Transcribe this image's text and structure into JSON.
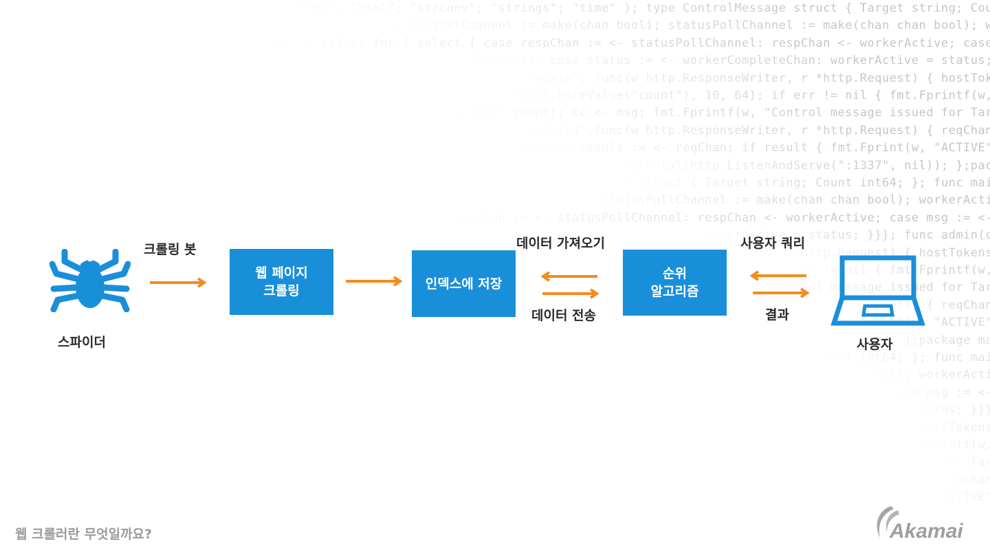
{
  "background_code": [
    "rt ( \"fmt\"; \"html\"; \"strconv\"; \"strings\"; \"time\" ); type ControlMessage struct { Target string; Cou",
    "n() { controlChannel := make(chan bool); statusPollChannel := make(chan chan bool); w",
    "tive := false; for { select { case respChan := <- statusPollChannel: respChan <- workerActive; case",
    "msg.Count); case status := <- workerCompleteChan: workerActive = status;",
    "e(\"/admin\", func(w http.ResponseWriter, r *http.Request) { hostTok",
    "rseInt(r.FormValue(\"count\"), 10, 64); if err != nil { fmt.Fprintf(w,",
    "ountErr: count}; cc <- msg; fmt.Fprintf(w, \"Control message issued for Tar",
    "c(\"/status\",func(w http.ResponseWriter, r *http.Request) { reqChan",
    "eqChan; result := <- reqChan; if result { fmt.Fprint(w, \"ACTIVE\"",
    "log.Fatal(http.ListenAndServe(\":1337\", nil)); };pac",
    "ge struct { Target string; Count int64; }; func mai",
    "l); statusPollChannel := make(chan chan bool); workerActi",
    "respChan := <- statusPollChannel: respChan <- workerActive; case msg := <-",
    "workerActive = status; }}}; func admin(c",
    "r *http.Request) { hostTokens",
    "err != nil { fmt.Fprintf(w,",
    "Control message issued for Tar",
    "Request) { reqChan",
    "fmt.Fprint(w, \"ACTIVE\"",
    "nil)); };package ma",
    "Count int64; }; func mai",
    "bool); workerActi",
    "case msg := <-",
    "status; }}}",
    "hostTokens",
    "Fprintf(w,",
    "for Tar",
    "reqChan",
    "\"ACTIVE\""
  ],
  "nodes": {
    "spider": {
      "label": "스파이더",
      "icon": "spider-icon"
    },
    "crawl_box": {
      "label": "웹 페이지\n크롤링"
    },
    "index_box": {
      "label": "인덱스에 저장"
    },
    "rank_box": {
      "label": "순위\n알고리즘"
    },
    "user": {
      "label": "사용자",
      "icon": "laptop-icon"
    }
  },
  "edges": {
    "bot": {
      "label": "크롤링 봇"
    },
    "fetch": {
      "label": "데이터 가져오기"
    },
    "send": {
      "label": "데이터 전송"
    },
    "query": {
      "label": "사용자 쿼리"
    },
    "result": {
      "label": "결과"
    }
  },
  "footer": {
    "title": "웹 크롤러란 무엇일까요?"
  },
  "logo": {
    "text": "Akamai"
  },
  "colors": {
    "box": "#1a8fd9",
    "arrow": "#f28c1e",
    "icon": "#1a8fd9",
    "code": "#e4e4e4",
    "footer": "#9a9a9a",
    "logo": "#9e9e9e"
  }
}
